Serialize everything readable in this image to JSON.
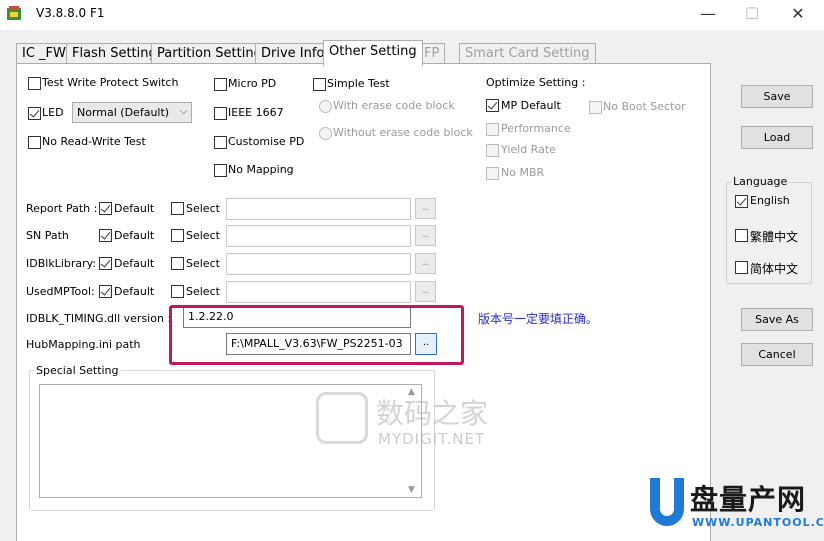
{
  "window": {
    "title": "V3.8.8.0 F1",
    "minimize": "—",
    "maximize": "☐",
    "close": "✕"
  },
  "tabs": [
    {
      "label": "IC _FW",
      "active": false,
      "enabled": true
    },
    {
      "label": "Flash Setting",
      "active": false,
      "enabled": true
    },
    {
      "label": "Partition Setting",
      "active": false,
      "enabled": true
    },
    {
      "label": "Drive Info",
      "active": false,
      "enabled": true
    },
    {
      "label": "Other Setting",
      "active": true,
      "enabled": true
    },
    {
      "label": "FP",
      "active": false,
      "enabled": false
    },
    {
      "label": "Smart Card Setting",
      "active": false,
      "enabled": false
    }
  ],
  "options": {
    "test_write_protect": {
      "label": "Test Write Protect Switch",
      "checked": false
    },
    "led": {
      "label": "LED",
      "checked": true
    },
    "led_mode": "Normal (Default)",
    "no_read_write": {
      "label": "No Read-Write Test",
      "checked": false
    },
    "micro_pd": {
      "label": "Micro PD",
      "checked": false
    },
    "ieee1667": {
      "label": "IEEE 1667",
      "checked": false
    },
    "customise_pd": {
      "label": "Customise PD",
      "checked": false
    },
    "no_mapping": {
      "label": "No Mapping",
      "checked": false
    },
    "simple_test": {
      "label": "Simple Test",
      "checked": false
    },
    "with_erase": {
      "label": "With erase code block"
    },
    "without_erase": {
      "label": "Without erase code block"
    }
  },
  "optimize": {
    "title": "Optimize Setting :",
    "mp_default": {
      "label": "MP Default",
      "checked": true
    },
    "no_boot_sector": {
      "label": "No Boot Sector",
      "checked": false
    },
    "performance": {
      "label": "Performance"
    },
    "yield_rate": {
      "label": "Yield Rate"
    },
    "no_mbr": {
      "label": "No MBR"
    }
  },
  "paths": [
    {
      "label": "Report Path :",
      "default_label": "Default",
      "select_label": "Select"
    },
    {
      "label": "SN Path",
      "default_label": "Default",
      "select_label": "Select"
    },
    {
      "label": "IDBlkLibrary:",
      "default_label": "Default",
      "select_label": "Select"
    },
    {
      "label": "UsedMPTool:",
      "default_label": "Default",
      "select_label": "Select"
    }
  ],
  "browse_label": "..",
  "idblk_timing": {
    "label": "IDBLK_TIMING.dll version :",
    "value": "1.2.22.0"
  },
  "hub_mapping": {
    "label": "HubMapping.ini path",
    "value": "F:\\MPALL_V3.63\\FW_PS2251-03"
  },
  "annotation": "版本号一定要填正确。",
  "special_setting": {
    "title": "Special Setting"
  },
  "buttons": {
    "save": "Save",
    "load": "Load",
    "save_as": "Save As",
    "cancel": "Cancel"
  },
  "language": {
    "title": "Language",
    "options": [
      {
        "label": "English",
        "checked": true
      },
      {
        "label": "繁體中文",
        "checked": false
      },
      {
        "label": "简体中文",
        "checked": false
      }
    ]
  },
  "watermarks": {
    "mydigit_cn": "数码之家",
    "mydigit_url": "MYDIGIT.NET",
    "upantool_cn": "盘量产网",
    "upantool_url": "WWW.UPANTOOL.COM"
  },
  "colors": {
    "highlight_box": "#c2185b",
    "annotation": "#2a2ad0",
    "upantool_blue": "#1f7ad6"
  }
}
